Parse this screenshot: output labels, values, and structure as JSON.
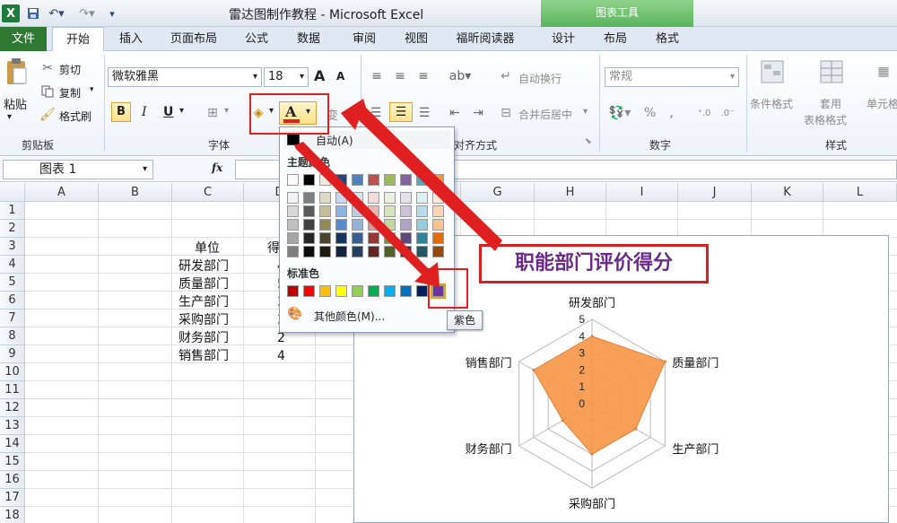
{
  "window": {
    "title": "雷达图制作教程 - Microsoft Excel",
    "context_tab_group": "图表工具",
    "app_icon": "excel-icon",
    "qa_toolbar": [
      "save-icon",
      "undo-icon",
      "redo-icon",
      "customize-icon"
    ]
  },
  "tabs": [
    "文件",
    "开始",
    "插入",
    "页面布局",
    "公式",
    "数据",
    "审阅",
    "视图",
    "福昕阅读器",
    "设计",
    "布局",
    "格式"
  ],
  "ribbon": {
    "clipboard": {
      "paste": "粘贴",
      "cut": "剪切",
      "copy": "复制",
      "format_painter": "格式刷",
      "label": "剪贴板"
    },
    "font": {
      "name": "微软雅黑",
      "size": "18",
      "grow": "A",
      "shrink": "A",
      "bold": "B",
      "italic": "I",
      "underline": "U",
      "font_color_letter": "A",
      "label": "字体",
      "phonetic": "变"
    },
    "alignment": {
      "wrap": "自动换行",
      "merge": "合并后居中",
      "label": "对齐方式"
    },
    "number": {
      "format": "常规",
      "percent": "%",
      "comma": ",",
      "label": "数字"
    },
    "styles": {
      "conditional": "条件格式",
      "table_line1": "套用",
      "table_line2": "表格格式",
      "cell": "单元格",
      "label": "样式"
    }
  },
  "formula_bar": {
    "name_box": "图表 1",
    "fx": "fx"
  },
  "sheet": {
    "columns": [
      "A",
      "B",
      "C",
      "D",
      "E",
      "F",
      "G",
      "H",
      "I",
      "J",
      "K",
      "L"
    ],
    "rows": [
      "1",
      "2",
      "3",
      "4",
      "5",
      "6",
      "7",
      "8",
      "9",
      "10",
      "11",
      "12",
      "13",
      "14",
      "15",
      "16",
      "17",
      "18"
    ],
    "header_unit": "单位",
    "header_score": "得分",
    "data": [
      {
        "unit": "研发部门",
        "score": "4"
      },
      {
        "unit": "质量部门",
        "score": "5"
      },
      {
        "unit": "生产部门",
        "score": "3"
      },
      {
        "unit": "采购部门",
        "score": "3"
      },
      {
        "unit": "财务部门",
        "score": "2"
      },
      {
        "unit": "销售部门",
        "score": "4"
      }
    ]
  },
  "color_panel": {
    "automatic": "自动(A)",
    "theme_title": "主题颜色",
    "standard_title": "标准色",
    "more_colors": "其他颜色(M)...",
    "tooltip": "紫色",
    "theme_top": [
      "#FFFFFF",
      "#000000",
      "#EEECE1",
      "#1F497D",
      "#4F81BD",
      "#C0504D",
      "#9BBB59",
      "#8064A2",
      "#4BACC6",
      "#F79646"
    ],
    "theme_shades": [
      [
        "#F2F2F2",
        "#7F7F7F",
        "#DDD9C3",
        "#C6D9F0",
        "#DBE5F1",
        "#F2DCDB",
        "#EBF1DD",
        "#E5E0EC",
        "#DBEEF3",
        "#FDEADA"
      ],
      [
        "#D8D8D8",
        "#595959",
        "#C4BD97",
        "#8DB3E2",
        "#B8CCE4",
        "#E5B9B7",
        "#D7E3BC",
        "#CCC1D9",
        "#B7DDE8",
        "#FBD5B5"
      ],
      [
        "#BFBFBF",
        "#3F3F3F",
        "#938953",
        "#548DD4",
        "#95B3D7",
        "#D99694",
        "#C3D69B",
        "#B2A2C7",
        "#92CDDC",
        "#FAC08F"
      ],
      [
        "#A5A5A5",
        "#262626",
        "#494429",
        "#17365D",
        "#366092",
        "#953734",
        "#76923C",
        "#5F497A",
        "#31859B",
        "#E36C09"
      ],
      [
        "#7F7F7F",
        "#0C0C0C",
        "#1D1B10",
        "#0F243E",
        "#244061",
        "#632423",
        "#4F6128",
        "#3F3151",
        "#205867",
        "#974806"
      ]
    ],
    "standard": [
      "#C00000",
      "#FF0000",
      "#FFC000",
      "#FFFF00",
      "#92D050",
      "#00B050",
      "#00B0F0",
      "#0070C0",
      "#002060",
      "#7030A0"
    ]
  },
  "chart_data": {
    "type": "radar",
    "title": "职能部门评价得分",
    "categories": [
      "研发部门",
      "质量部门",
      "生产部门",
      "采购部门",
      "财务部门",
      "销售部门"
    ],
    "series": [
      {
        "values": [
          4,
          5,
          3,
          3,
          2,
          4
        ]
      }
    ],
    "ticks": [
      "0",
      "1",
      "2",
      "3",
      "4",
      "5"
    ],
    "rmax": 5,
    "fill_color": "#F79646"
  },
  "colors": {
    "annotation_red": "#E02020",
    "title_purple": "#6A2A8A"
  }
}
